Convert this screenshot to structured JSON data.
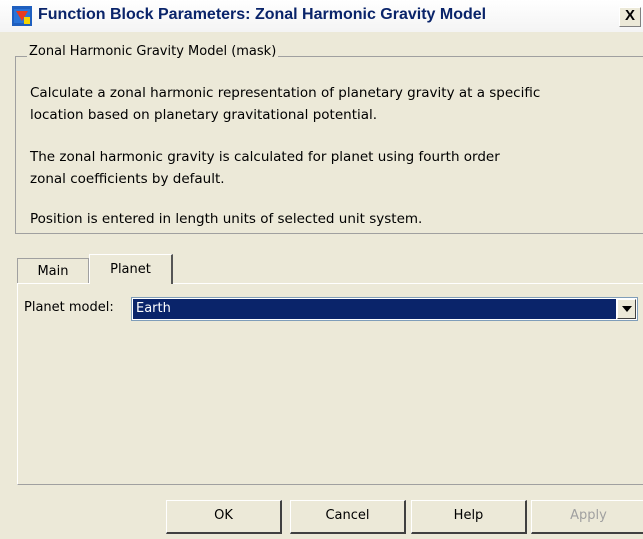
{
  "window": {
    "title": "Function Block Parameters: Zonal Harmonic Gravity Model",
    "close_label": "X"
  },
  "mask": {
    "group_title": "Zonal Harmonic Gravity Model (mask)",
    "description": [
      "Calculate a zonal harmonic representation of planetary gravity at a specific",
      "location based on planetary gravitational potential.",
      "The zonal harmonic gravity is calculated for planet using fourth order",
      "zonal coefficients by default.",
      "Position is entered in length units of selected unit system."
    ]
  },
  "tabs": [
    {
      "label": "Main",
      "active": false
    },
    {
      "label": "Planet",
      "active": true
    }
  ],
  "planet": {
    "model_label": "Planet model:",
    "model_value": "Earth"
  },
  "buttons": {
    "ok": "OK",
    "cancel": "Cancel",
    "help": "Help",
    "apply": "Apply"
  },
  "colors": {
    "title_text": "#0a246a",
    "selection": "#0a246a",
    "dialog_bg": "#ece9d8"
  }
}
